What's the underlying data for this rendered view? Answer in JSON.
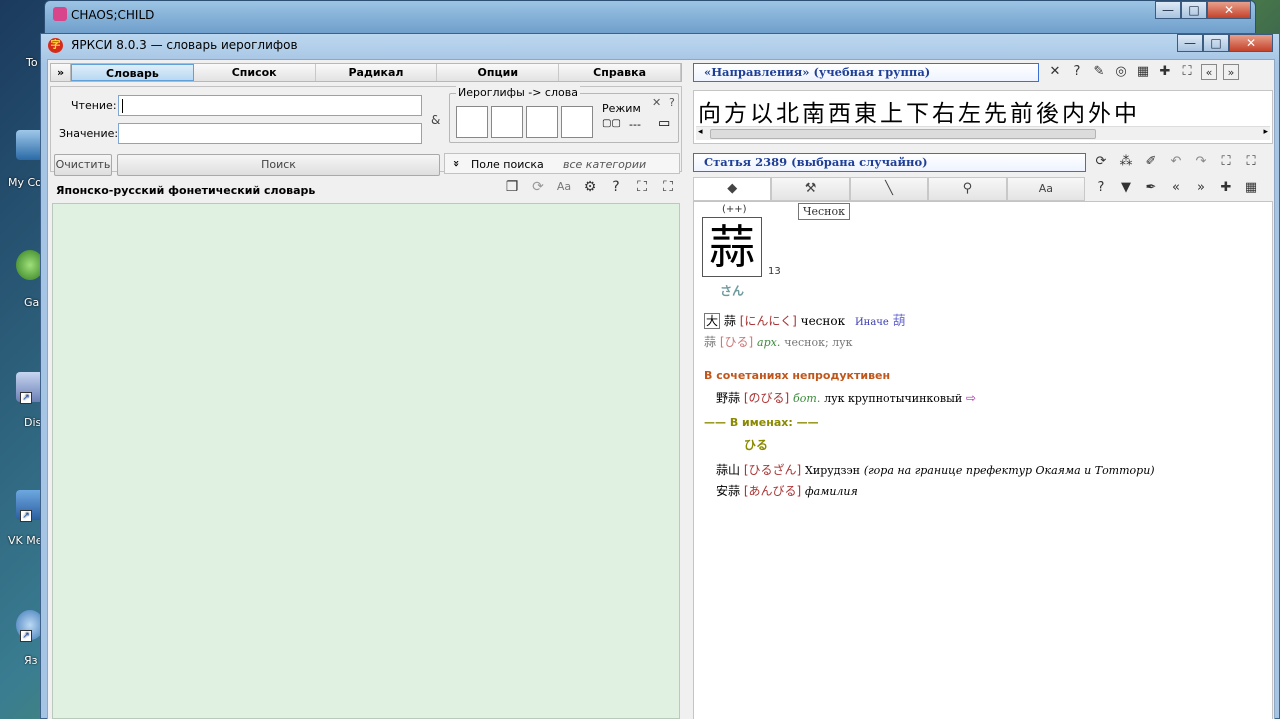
{
  "desktop_icons": [
    {
      "label": "To"
    },
    {
      "label": "My Co"
    },
    {
      "label": "Ga"
    },
    {
      "label": "Dis"
    },
    {
      "label": "VK Me"
    },
    {
      "label": "Яз"
    }
  ],
  "back_window": {
    "title": "CHAOS;CHILD"
  },
  "window": {
    "title": "ЯРКСИ 8.0.3  — словарь иероглифов",
    "min": "—",
    "max": "□",
    "close": "✕"
  },
  "menu": {
    "toggle": "»",
    "items": [
      "Словарь",
      "Список",
      "Радикал",
      "Опции",
      "Справка"
    ]
  },
  "search": {
    "reading_label": "Чтение:",
    "meaning_label": "Значение:",
    "reading_value": "",
    "meaning_value": "",
    "amp": "&",
    "kanji_to_words": "Иероглифы -> слова",
    "mode_label": "Режим",
    "mode_close": "✕",
    "mode_help": "?",
    "mode_a": "▢▢",
    "mode_b": "---",
    "mode_c": "▭",
    "clear_button": "Очистить",
    "search_button": "Поиск",
    "field_toggle": "»",
    "field_label": "Поле поиска",
    "field_value": "все категории"
  },
  "dictionary": {
    "title": "Японско-русский фонетический словарь"
  },
  "right": {
    "directions": "«Направления»  (учебная группа)",
    "kanji_row": "向方以北南西東上下右左先前後内外中",
    "article_header": "Статья 2389  (выбрана случайно)",
    "tooltip": "Чеснок"
  },
  "entry": {
    "plusplus": "(++)",
    "kanji": "蒜",
    "strokes": "13",
    "onyomi": "さん",
    "line1": {
      "bracket": "大",
      "word": "蒜",
      "reading": "[にんにく]",
      "meaning": "чеснок",
      "alt_label": "Иначе",
      "alt_kanji": "葫"
    },
    "line2": {
      "word": "蒜",
      "reading": "[ひる]",
      "tag": "арх.",
      "meaning": "чеснок; лук"
    },
    "section1": "В сочетаниях непродуктивен",
    "line3": {
      "word": "野蒜",
      "reading": "[のびる]",
      "tag": "бот.",
      "meaning": "лук крупнотычинковый",
      "arrow": "⇨"
    },
    "names_header": "В именах:",
    "names_dash": "——",
    "names_reading": "ひる",
    "line4": {
      "word": "蒜山",
      "reading": "[ひるざん]",
      "meaning": "Хирудзэн",
      "note": "(гора на границе префектур Окаяма и Тоттори)"
    },
    "line5": {
      "word": "安蒜",
      "reading": "[あんびる]",
      "note": "фамилия"
    }
  },
  "colors": {
    "accent": "#1f3f96",
    "highlight": "#b12a2a",
    "section": "#c0561b",
    "names": "#8a8a00",
    "green_bg": "#e0f1e2"
  }
}
